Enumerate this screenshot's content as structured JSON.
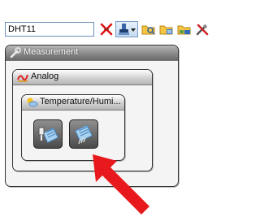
{
  "search": {
    "value": "DHT11"
  },
  "toolbar": {
    "icons": [
      "clear-filter-icon",
      "component-select-icon",
      "folder-search-icon",
      "folder-list-icon",
      "folder-share-icon",
      "tools-icon"
    ]
  },
  "panels": {
    "measurement": {
      "label": "Measurement",
      "icon": "wrench-icon"
    },
    "analog": {
      "label": "Analog",
      "icon": "analog-icon"
    },
    "temperature": {
      "label": "Temperature/Humi...",
      "icon": "weather-icon"
    }
  },
  "components": [
    {
      "icon": "dht-sensor-usb-icon"
    },
    {
      "icon": "dht-sensor-icon"
    }
  ],
  "colors": {
    "arrow": "#e8191c",
    "accent": "#6f8fb8"
  }
}
